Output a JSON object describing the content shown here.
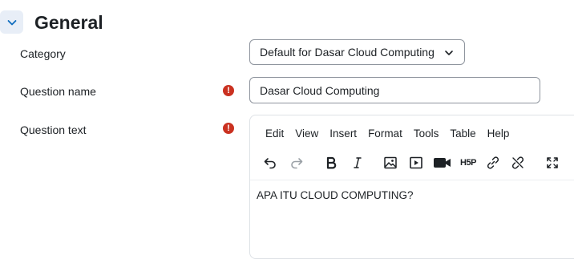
{
  "section": {
    "title": "General"
  },
  "form": {
    "category_label": "Category",
    "category_value": "Default for Dasar Cloud Computing",
    "name_label": "Question name",
    "name_value": "Dasar Cloud Computing",
    "text_label": "Question text",
    "required_icon": "exclamation-circle-icon"
  },
  "editor": {
    "menu": [
      "Edit",
      "View",
      "Insert",
      "Format",
      "Tools",
      "Table",
      "Help"
    ],
    "h5p_label": "H5P",
    "content": "APA ITU CLOUD COMPUTING?"
  },
  "colors": {
    "required": "#ca3120",
    "collapse_bg": "#e8eef7",
    "accent": "#0f6cbf"
  }
}
